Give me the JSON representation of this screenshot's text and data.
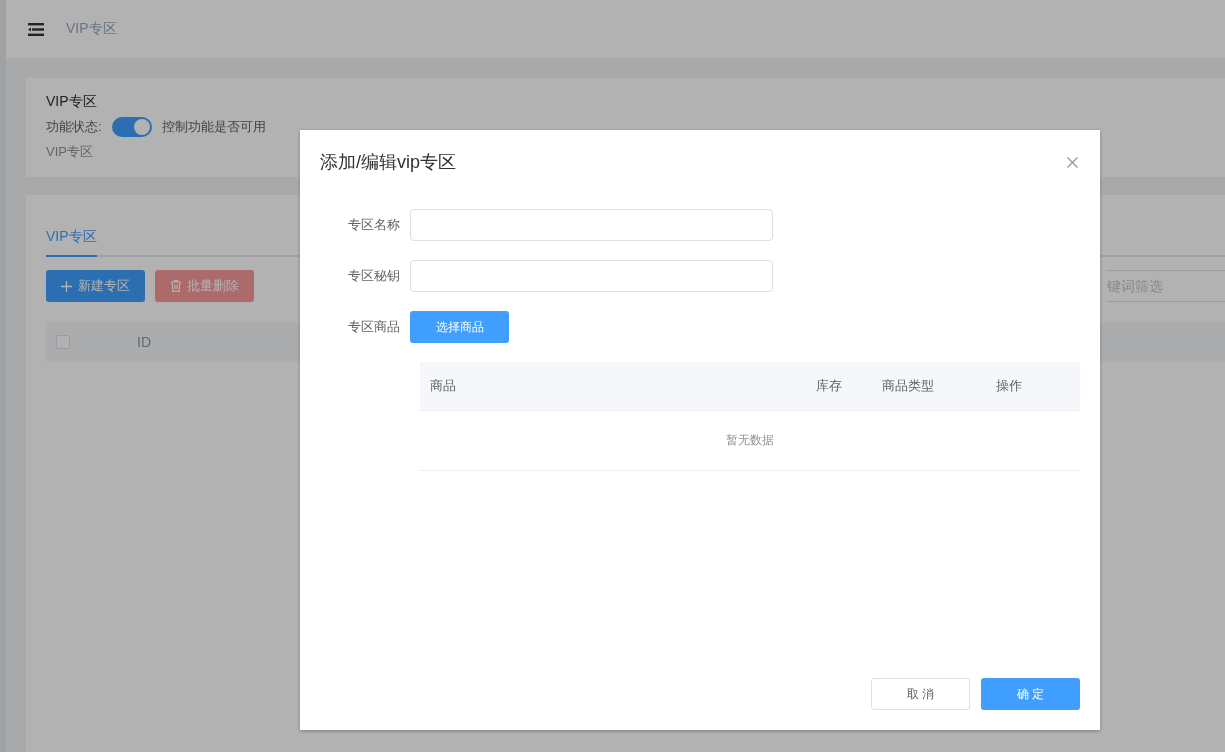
{
  "header": {
    "breadcrumb": "VIP专区"
  },
  "feature_card": {
    "title": "VIP专区",
    "status_label": "功能状态:",
    "switch_on": true,
    "switch_hint": "控制功能是否可用",
    "subtitle": "VIP专区"
  },
  "panel": {
    "tabs": [
      {
        "label": "VIP专区",
        "selected": true
      }
    ],
    "buttons": [
      {
        "label": "新建专区",
        "kind": "primary"
      },
      {
        "label": "批量删除",
        "kind": "danger"
      }
    ],
    "search": {
      "placeholder": "键词筛选"
    },
    "table": {
      "select_all_checked": false,
      "columns": [
        "ID"
      ]
    }
  },
  "dialog": {
    "title": "添加/编辑vip专区",
    "fields": [
      {
        "label": "专区名称",
        "kind": "input"
      },
      {
        "label": "专区秘钥",
        "kind": "input"
      },
      {
        "label": "专区商品",
        "kind": "button",
        "button": "选择商品"
      }
    ],
    "table": {
      "columns": [
        "商品",
        "库存",
        "商品类型",
        "操作"
      ],
      "empty_text": "暂无数据"
    },
    "buttons": [
      {
        "label": "取 消",
        "kind": "default"
      },
      {
        "label": "确 定",
        "kind": "primary"
      }
    ]
  }
}
